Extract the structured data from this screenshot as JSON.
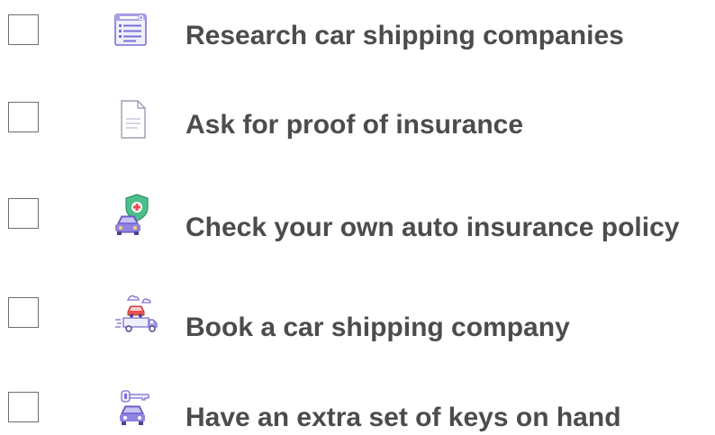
{
  "checklist": {
    "items": [
      {
        "label": "Research car shipping companies",
        "checked": false,
        "icon": "browser-search-icon"
      },
      {
        "label": "Ask for proof of insurance",
        "checked": false,
        "icon": "document-icon"
      },
      {
        "label": "Check your own auto insurance policy",
        "checked": false,
        "icon": "car-shield-icon"
      },
      {
        "label": "Book a car shipping company",
        "checked": false,
        "icon": "car-transport-truck-icon"
      },
      {
        "label": "Have an extra set of keys on hand",
        "checked": false,
        "icon": "car-key-icon"
      }
    ]
  },
  "colors": {
    "text": "#4c4c4c",
    "checkbox_border": "#6e6e6e",
    "icon_purple": "#7b6fd6",
    "icon_red": "#e8504f",
    "icon_green": "#4cbf8c"
  }
}
